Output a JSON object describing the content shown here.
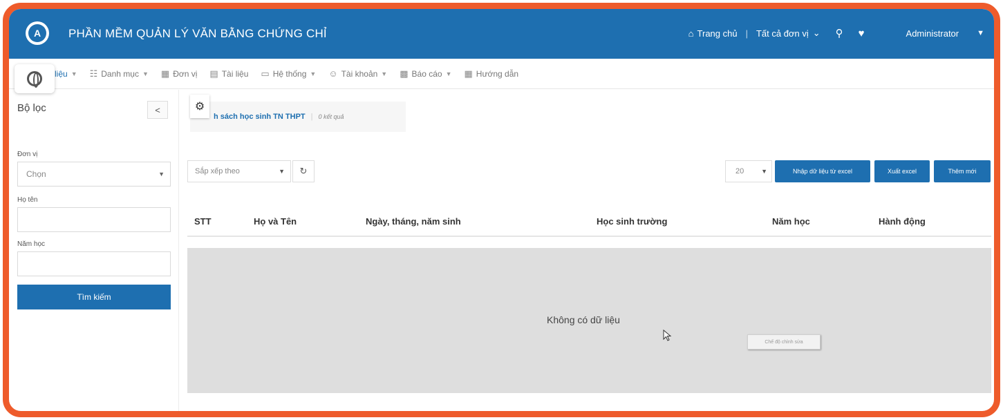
{
  "header": {
    "title": "PHẦN MỀM QUẢN LÝ VĂN BẰNG CHỨNG CHỈ",
    "home_label": "Trang chủ",
    "separator": "|",
    "units_label": "Tất cả đơn vị",
    "user_label": "Administrator"
  },
  "menu": {
    "items": [
      {
        "label": "liệu",
        "icon": "globe-icon"
      },
      {
        "label": "Danh mục",
        "icon": "sitemap-icon"
      },
      {
        "label": "Đơn vị",
        "icon": "building-icon"
      },
      {
        "label": "Tài liệu",
        "icon": "document-icon"
      },
      {
        "label": "Hệ thống",
        "icon": "monitor-icon"
      },
      {
        "label": "Tài khoản",
        "icon": "user-icon"
      },
      {
        "label": "Báo cáo",
        "icon": "table-icon"
      },
      {
        "label": "Hướng dẫn",
        "icon": "building-icon"
      }
    ]
  },
  "filter": {
    "title": "Bộ lọc",
    "collapse_symbol": "<",
    "unit_label": "Đơn vị",
    "unit_value": "Chọn",
    "name_label": "Họ tên",
    "name_value": "",
    "year_label": "Năm học",
    "year_value": "",
    "search_button": "Tìm kiếm"
  },
  "page": {
    "title_partial": "h sách học sinh TN THPT",
    "result_count": "0 kết quả"
  },
  "toolbar": {
    "sort_label": "Sắp xếp theo",
    "page_size": "20",
    "import_button": "Nhập dữ liệu từ excel",
    "export_button": "Xuất excel",
    "add_button": "Thêm mới"
  },
  "table": {
    "columns": [
      "STT",
      "Họ và Tên",
      "Ngày, tháng, năm sinh",
      "Học sinh trường",
      "Năm học",
      "Hành động"
    ],
    "empty_message": "Không có dữ liệu",
    "tooltip_text": "Chế độ chỉnh sửa"
  },
  "colors": {
    "primary": "#1e6fb0",
    "frame": "#ee5b2b",
    "empty_bg": "#dedede"
  }
}
